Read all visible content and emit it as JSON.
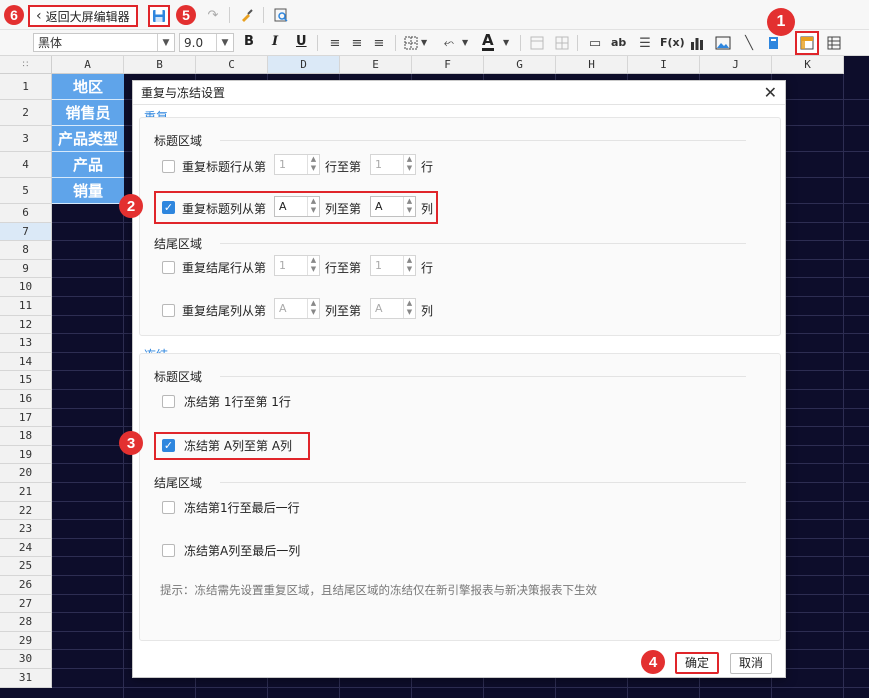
{
  "toolbar": {
    "back_label": "返回大屏编辑器",
    "font_name": "黑体",
    "font_size": "9.0",
    "bold": "B",
    "italic": "I",
    "underline": "U",
    "text_label": "ab",
    "formula_label": "F(x)"
  },
  "markers": {
    "m1": "1",
    "m2": "2",
    "m3": "3",
    "m4": "4",
    "m5": "5",
    "m6": "6"
  },
  "grid": {
    "columns": [
      "A",
      "B",
      "C",
      "D",
      "E",
      "F",
      "G",
      "H",
      "I",
      "J",
      "K"
    ],
    "rows": [
      "1",
      "2",
      "3",
      "4",
      "5",
      "6",
      "7",
      "8",
      "9",
      "10",
      "11",
      "12",
      "13",
      "14",
      "15",
      "16",
      "17",
      "18",
      "19",
      "20",
      "21",
      "22",
      "23",
      "24",
      "25",
      "26",
      "27",
      "28",
      "29",
      "30",
      "31"
    ],
    "a_cells": [
      "地区",
      "销售员",
      "产品类型",
      "产品",
      "销量"
    ]
  },
  "dialog": {
    "title": "重复与冻结设置",
    "repeat": {
      "section": "重复",
      "title_area": "标题区域",
      "row_from": "重复标题行从第",
      "row_to": "行至第",
      "row_unit": "行",
      "row_from_val": "1",
      "row_to_val": "1",
      "col_from": "重复标题列从第",
      "col_to": "列至第",
      "col_unit": "列",
      "col_from_val": "A",
      "col_to_val": "A",
      "footer_area": "结尾区域",
      "frow_from": "重复结尾行从第",
      "frow_to": "行至第",
      "frow_unit": "行",
      "frow_from_val": "1",
      "frow_to_val": "1",
      "fcol_from": "重复结尾列从第",
      "fcol_to": "列至第",
      "fcol_unit": "列",
      "fcol_from_val": "A",
      "fcol_to_val": "A"
    },
    "freeze": {
      "section": "冻结",
      "title_area": "标题区域",
      "row_text": "冻结第 1行至第 1行",
      "col_text": "冻结第 A列至第 A列",
      "footer_area": "结尾区域",
      "frow_text": "冻结第1行至最后一行",
      "fcol_text": "冻结第A列至最后一列"
    },
    "hint": "提示：冻结需先设置重复区域，且结尾区域的冻结仅在新引擎报表与新决策报表下生效",
    "ok": "确定",
    "cancel": "取消"
  }
}
